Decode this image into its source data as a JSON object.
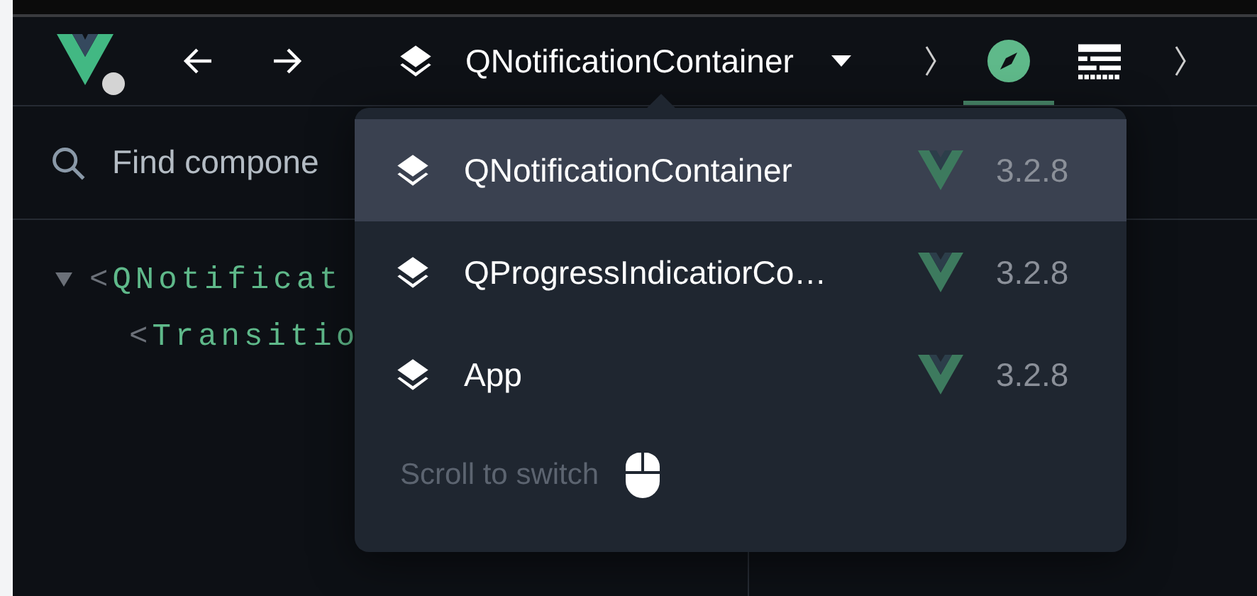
{
  "toolbar": {
    "title": "QNotificationContainer",
    "tabs": [
      {
        "kind": "compass",
        "selected": true
      },
      {
        "kind": "table",
        "selected": false
      }
    ]
  },
  "search": {
    "placeholder": "Find compone"
  },
  "tree": [
    {
      "bracket": "<",
      "name": "QNotificat",
      "expanded": true,
      "children": [
        {
          "bracket": "<",
          "name": "Transitio"
        }
      ]
    }
  ],
  "popup": {
    "items": [
      {
        "name": "QNotificationContainer",
        "version": "3.2.8",
        "selected": true
      },
      {
        "name": "QProgressIndicatiorCo…",
        "version": "3.2.8",
        "selected": false
      },
      {
        "name": "App",
        "version": "3.2.8",
        "selected": false
      }
    ],
    "hint": "Scroll to switch"
  }
}
